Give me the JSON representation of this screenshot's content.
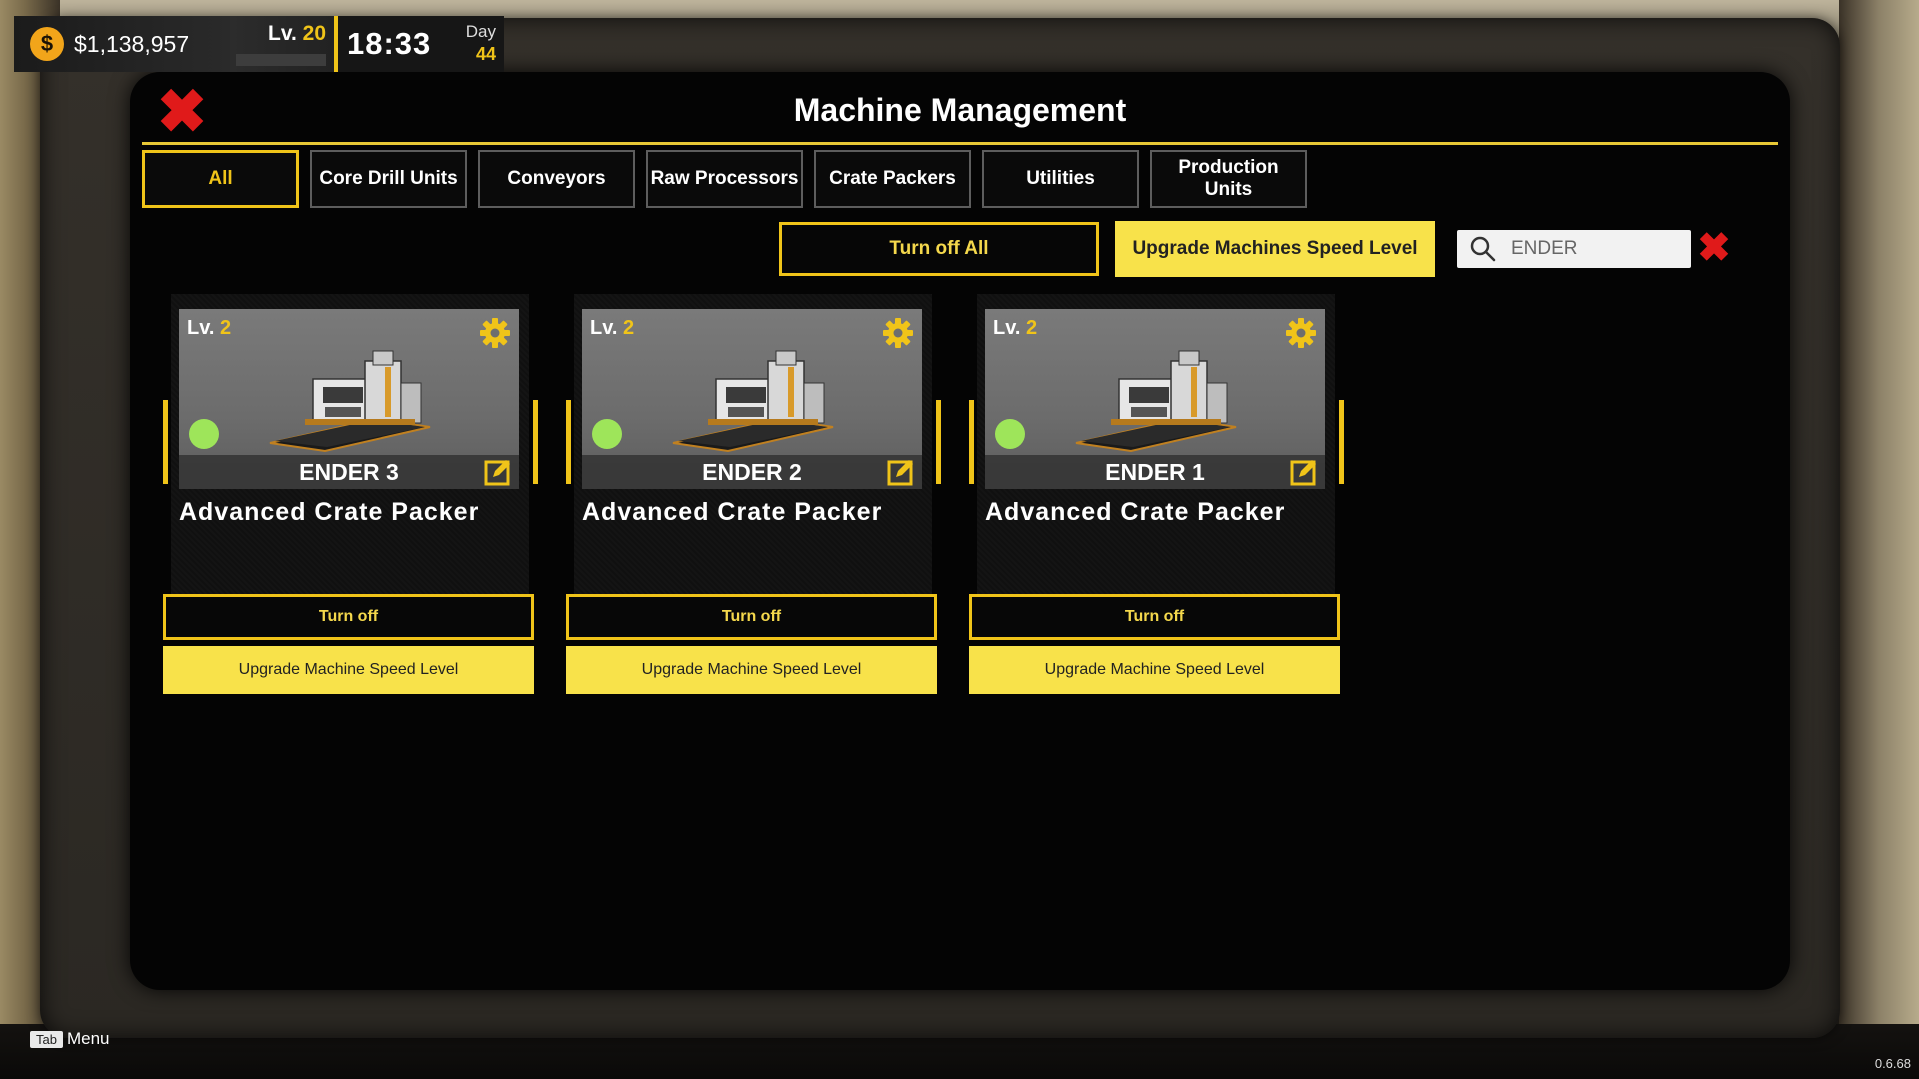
{
  "hud": {
    "money": "$1,138,957",
    "coin_symbol": "$",
    "level_prefix": "Lv.",
    "level_value": "20",
    "time": "18:33",
    "day_label": "Day",
    "day_value": "44"
  },
  "header": {
    "title": "Machine Management",
    "close_glyph": "✖"
  },
  "tabs": [
    {
      "label": "All",
      "active": true
    },
    {
      "label": "Core Drill Units",
      "active": false
    },
    {
      "label": "Conveyors",
      "active": false
    },
    {
      "label": "Raw Processors",
      "active": false
    },
    {
      "label": "Crate Packers",
      "active": false
    },
    {
      "label": "Utilities",
      "active": false
    },
    {
      "label": "Production Units",
      "active": false
    }
  ],
  "toolbar": {
    "turn_off_all": "Turn off All",
    "upgrade_all": "Upgrade Machines Speed Level",
    "search_value": "ENDER",
    "clear_glyph": "✖"
  },
  "machines": [
    {
      "level_prefix": "Lv.",
      "level": "2",
      "name": "ENDER 3",
      "type": "Advanced Crate Packer",
      "turn_off": "Turn off",
      "upgrade": "Upgrade Machine Speed Level",
      "status": "on"
    },
    {
      "level_prefix": "Lv.",
      "level": "2",
      "name": "ENDER 2",
      "type": "Advanced Crate Packer",
      "turn_off": "Turn off",
      "upgrade": "Upgrade Machine Speed Level",
      "status": "on"
    },
    {
      "level_prefix": "Lv.",
      "level": "2",
      "name": "ENDER 1",
      "type": "Advanced Crate Packer",
      "turn_off": "Turn off",
      "upgrade": "Upgrade Machine Speed Level",
      "status": "on"
    }
  ],
  "footer": {
    "key": "Tab",
    "menu": "Menu",
    "version": "0.6.68"
  },
  "colors": {
    "accent": "#f0c419",
    "upgrade_bg": "#f8e24a",
    "close": "#e01a1a",
    "status_on": "#9ee55a"
  },
  "icons": [
    "coin-icon",
    "close-icon",
    "search-icon",
    "gear-icon",
    "edit-icon"
  ]
}
